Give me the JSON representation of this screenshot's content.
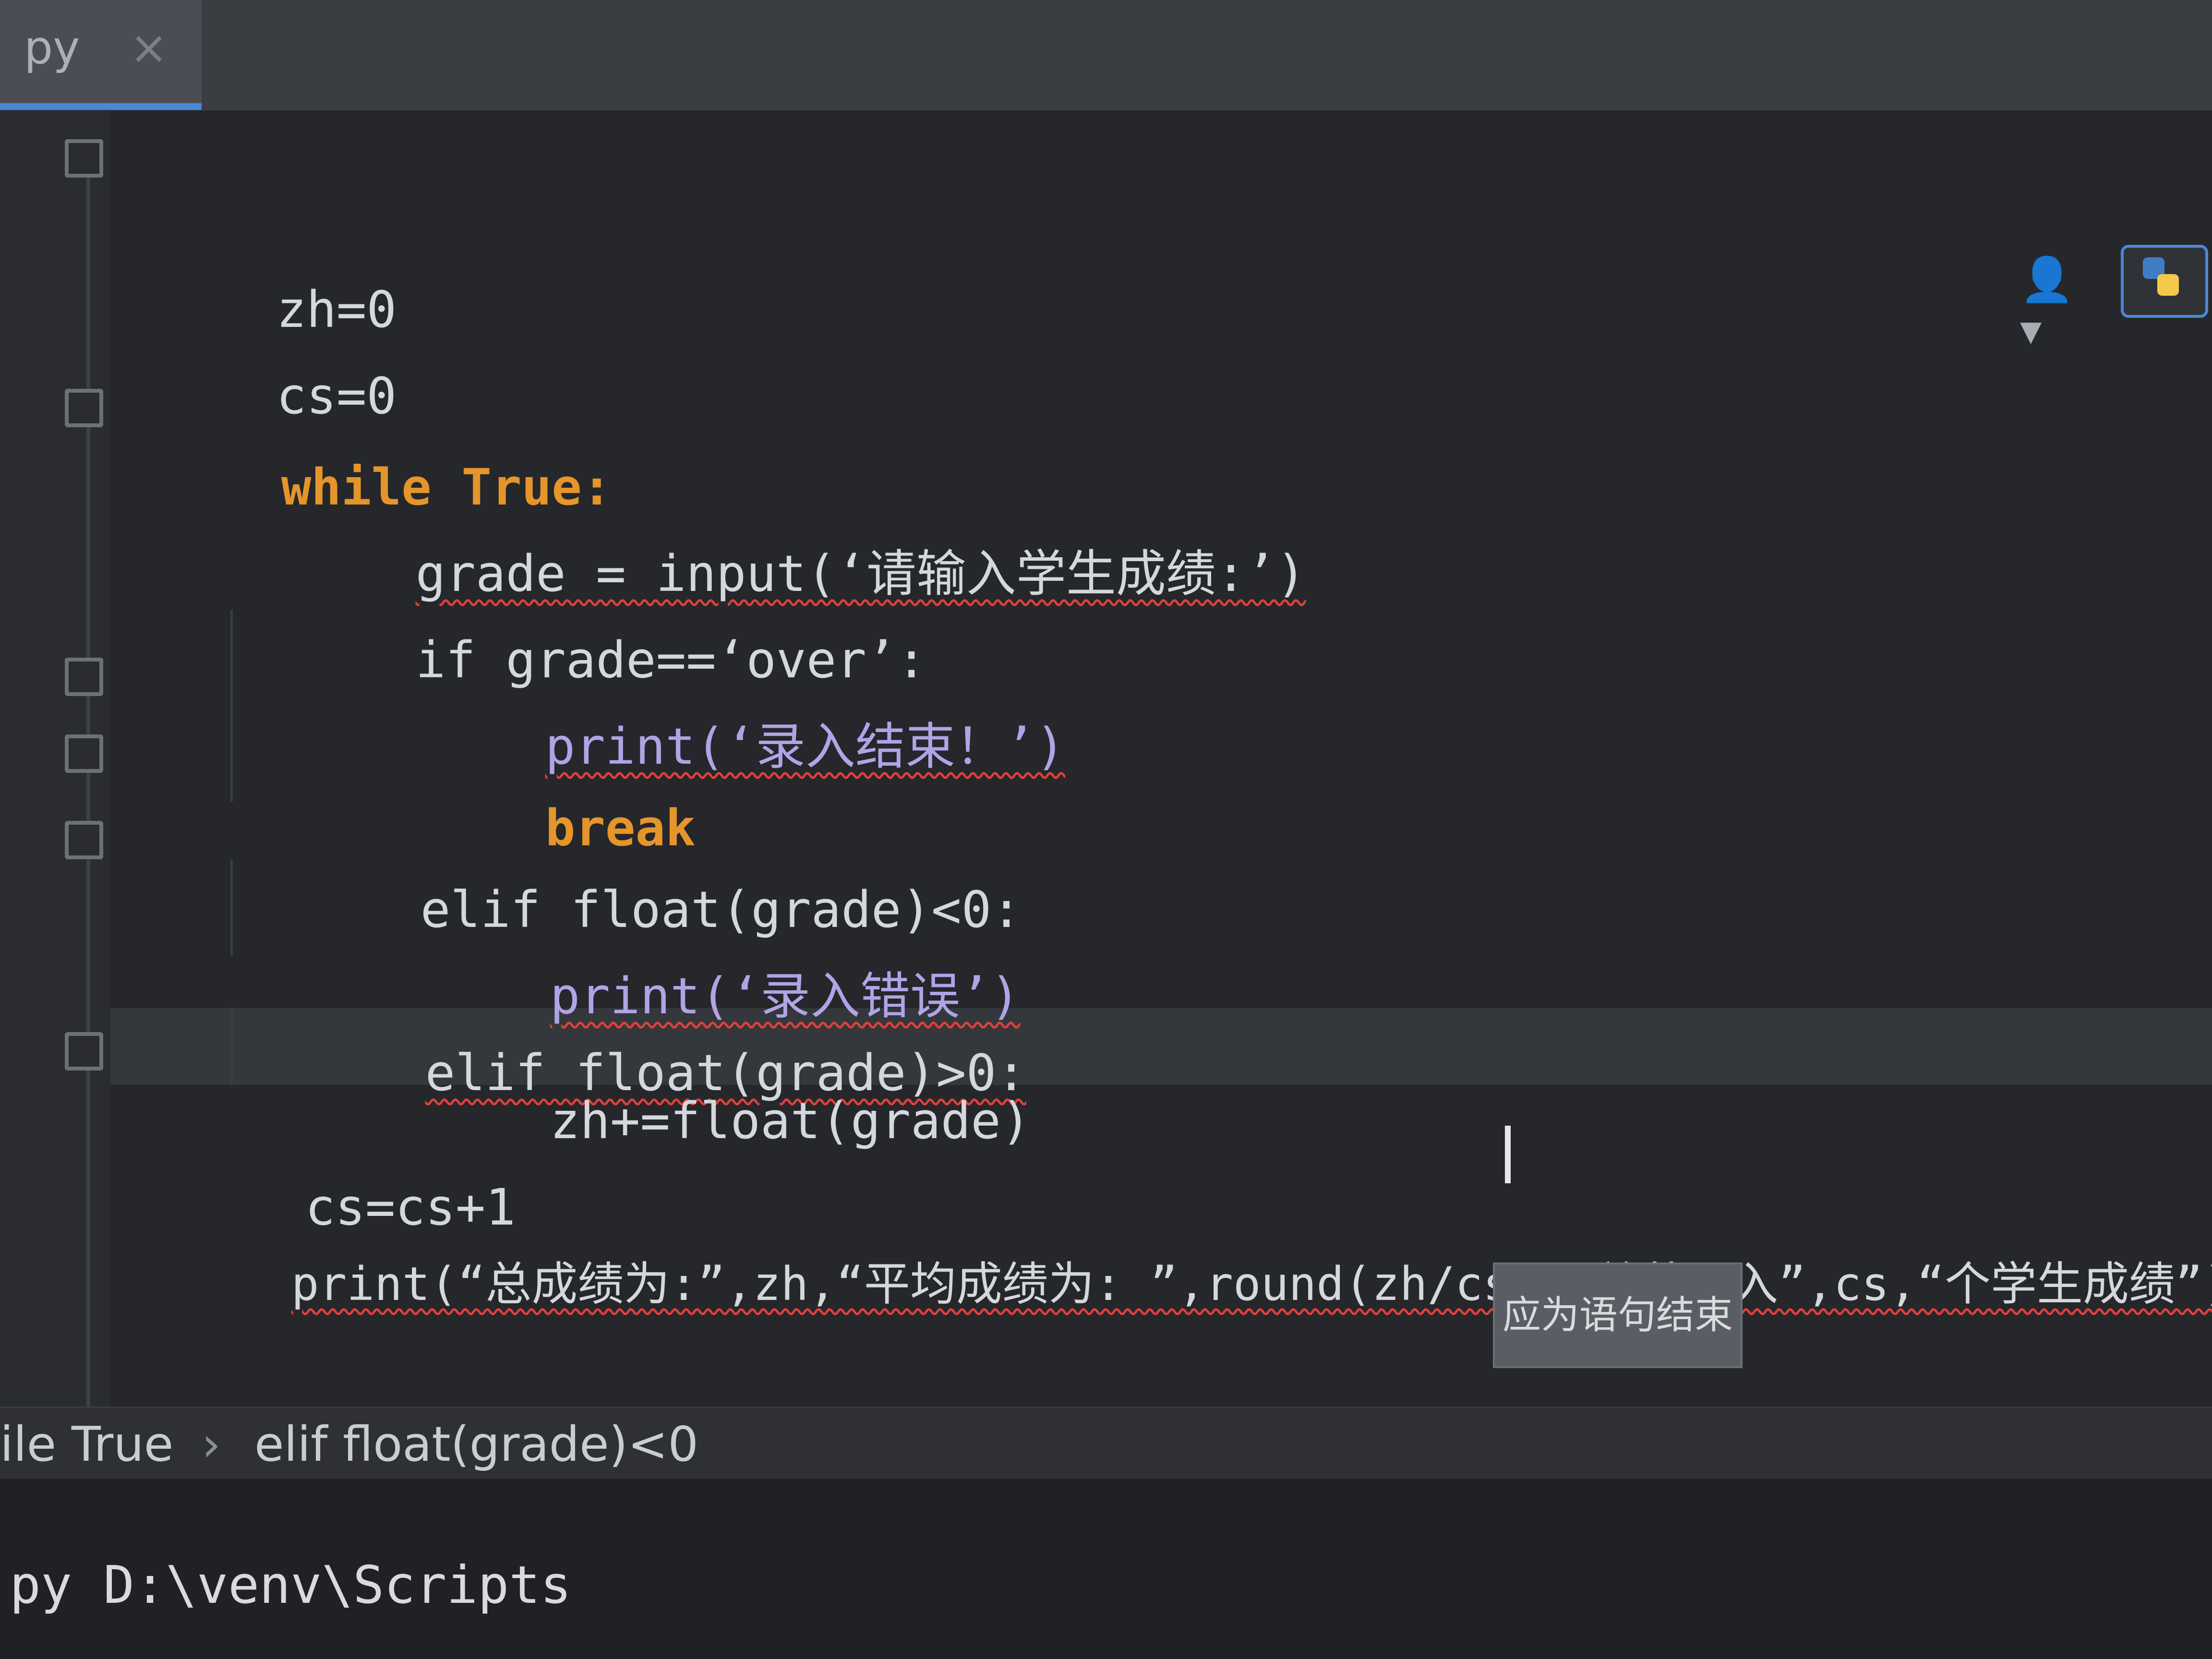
{
  "tab": {
    "label": "py",
    "close": "×"
  },
  "editor": {
    "lines": [
      {
        "text": "zh=0"
      },
      {
        "text": "cs=0"
      },
      {
        "text": "while True:"
      },
      {
        "text": "grade = input(‘请输入学生成绩:’)"
      },
      {
        "text": "if grade==‘over’:"
      },
      {
        "text": "print(‘录入结束！’)"
      },
      {
        "text": "break"
      },
      {
        "text": "elif float(grade)<0:"
      },
      {
        "text": "print(‘录入错误’)"
      },
      {
        "text": "elif float(grade)>0:"
      },
      {
        "text": "zh+=float(grade)"
      },
      {
        "text": "cs=cs+1"
      },
      {
        "text": "print(“总成绩为:”,zh,“平均成绩为: ”,round(zh/cs),“总共录入”,cs,“个学生成绩”)"
      }
    ]
  },
  "tooltip": {
    "text": "应为语句结束"
  },
  "breadcrumb": {
    "items": [
      "ile True",
      "elif float(grade)<0"
    ],
    "separator": "›"
  },
  "terminal": {
    "text": "py D:\\venv\\Scripts"
  },
  "colors": {
    "keyword": "#e5952b",
    "number": "#40b4d4",
    "function": "#b0a4e6",
    "error": "#e0403a",
    "accent": "#4a88d6"
  }
}
